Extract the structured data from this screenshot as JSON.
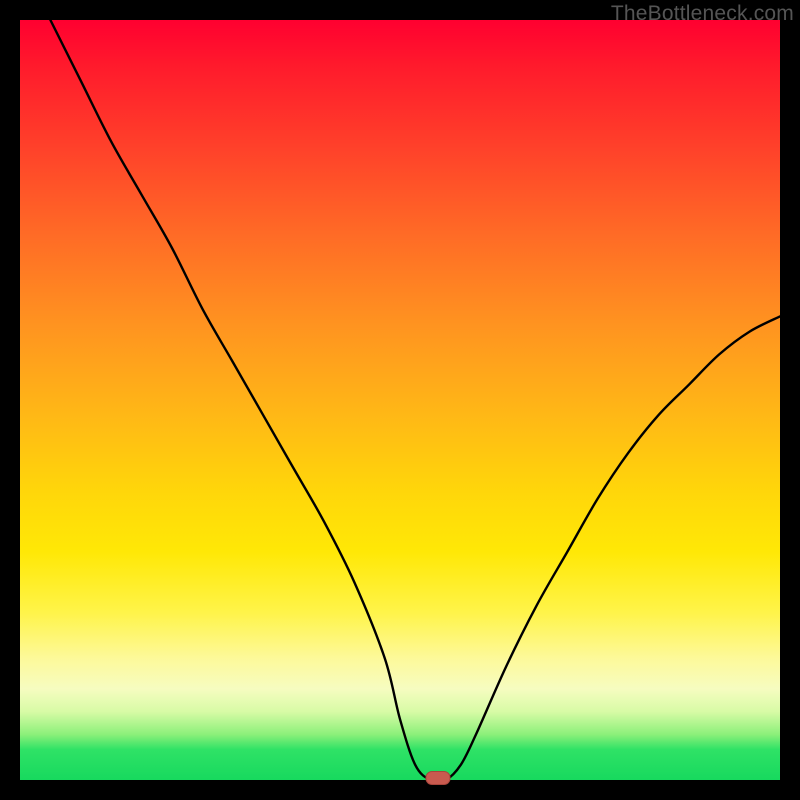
{
  "watermark": "TheBottleneck.com",
  "chart_data": {
    "type": "line",
    "title": "",
    "xlabel": "",
    "ylabel": "",
    "xlim": [
      0,
      100
    ],
    "ylim": [
      0,
      100
    ],
    "grid": false,
    "series": [
      {
        "name": "bottleneck-curve",
        "x": [
          4,
          8,
          12,
          16,
          20,
          24,
          28,
          32,
          36,
          40,
          44,
          48,
          50,
          52,
          54,
          56,
          58,
          60,
          64,
          68,
          72,
          76,
          80,
          84,
          88,
          92,
          96,
          100
        ],
        "y": [
          100,
          92,
          84,
          77,
          70,
          62,
          55,
          48,
          41,
          34,
          26,
          16,
          8,
          2,
          0,
          0,
          2,
          6,
          15,
          23,
          30,
          37,
          43,
          48,
          52,
          56,
          59,
          61
        ]
      }
    ],
    "background_gradient": {
      "top": "#ff0030",
      "mid_upper": "#ff9320",
      "mid": "#ffe806",
      "mid_lower": "#f6fcc0",
      "bottom": "#17d95e"
    },
    "marker": {
      "x": 55,
      "y": 0,
      "color": "#c95a4f"
    }
  }
}
